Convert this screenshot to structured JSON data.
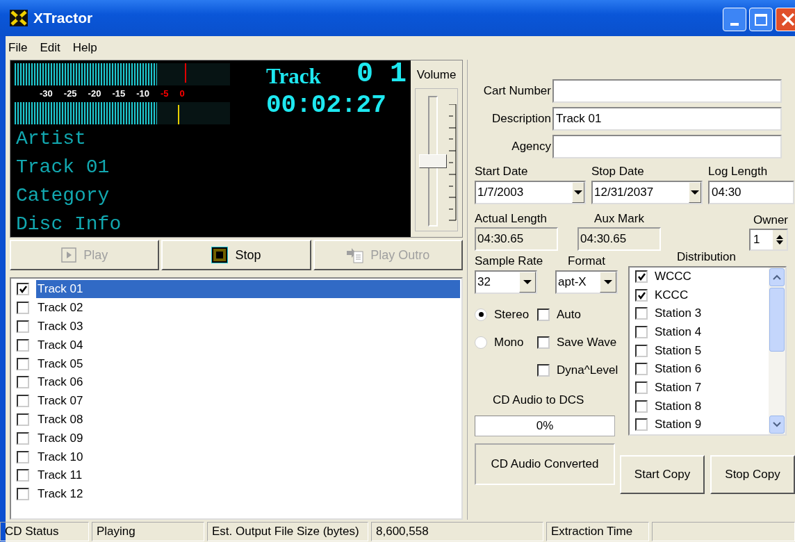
{
  "window": {
    "title": "XTractor"
  },
  "menu": [
    "File",
    "Edit",
    "Help"
  ],
  "display": {
    "meters": [
      {
        "level": 0.66
      },
      {
        "level": 0.66
      }
    ],
    "scale": [
      {
        "label": "-30",
        "color": "#ffffff"
      },
      {
        "label": "-25",
        "color": "#ffffff"
      },
      {
        "label": "-20",
        "color": "#ffffff"
      },
      {
        "label": "-15",
        "color": "#ffffff"
      },
      {
        "label": "-10",
        "color": "#ffffff"
      },
      {
        "label": "-5",
        "color": "#ff0000"
      },
      {
        "label": "0",
        "color": "#ff0000"
      }
    ],
    "track_label": "Track",
    "track_number": "0 1",
    "time": "00:02:27",
    "info_lines": [
      "Artist",
      "Track 01",
      "Category",
      "Disc Info"
    ]
  },
  "volume": {
    "label": "Volume",
    "level": 0.5
  },
  "transport": [
    {
      "label": "Play",
      "kind": "play",
      "disabled": true
    },
    {
      "label": "Stop",
      "kind": "stop",
      "disabled": false
    },
    {
      "label": "Play Outro",
      "kind": "outro",
      "disabled": true
    }
  ],
  "tracks": [
    {
      "label": "Track 01",
      "checked": true,
      "selected": true
    },
    {
      "label": "Track 02",
      "checked": false,
      "selected": false
    },
    {
      "label": "Track 03",
      "checked": false,
      "selected": false
    },
    {
      "label": "Track 04",
      "checked": false,
      "selected": false
    },
    {
      "label": "Track 05",
      "checked": false,
      "selected": false
    },
    {
      "label": "Track 06",
      "checked": false,
      "selected": false
    },
    {
      "label": "Track 07",
      "checked": false,
      "selected": false
    },
    {
      "label": "Track 08",
      "checked": false,
      "selected": false
    },
    {
      "label": "Track 09",
      "checked": false,
      "selected": false
    },
    {
      "label": "Track 10",
      "checked": false,
      "selected": false
    },
    {
      "label": "Track 11",
      "checked": false,
      "selected": false
    },
    {
      "label": "Track 12",
      "checked": false,
      "selected": false
    }
  ],
  "fields": [
    {
      "label": "Cart Number"
    },
    {
      "label": "Description",
      "value": "Track 01"
    },
    {
      "label": "Agency"
    }
  ],
  "dates": [
    {
      "label": "Start Date",
      "value": "1/7/2003",
      "kind": "dropdown"
    },
    {
      "label": "Stop Date",
      "value": "12/31/2037",
      "kind": "dropdown"
    },
    {
      "label": "Log Length",
      "value": "04:30",
      "kind": "text"
    }
  ],
  "lengths": [
    {
      "label": "Actual Length",
      "value": "04:30.65"
    },
    {
      "label": "Aux Mark",
      "value": "04:30.65"
    }
  ],
  "owner": {
    "label": "Owner",
    "value": "1"
  },
  "sample_rate": {
    "label": "Sample Rate",
    "value": "32"
  },
  "format": {
    "label": "Format",
    "value": "apt-X"
  },
  "channels": [
    {
      "label": "Stereo",
      "selected": true
    },
    {
      "label": "Mono",
      "selected": false
    }
  ],
  "options": [
    {
      "label": "Auto",
      "checked": false
    },
    {
      "label": "Save Wave",
      "checked": false
    },
    {
      "label": "Dyna^Level",
      "checked": false
    }
  ],
  "conversion": {
    "label": "CD Audio to DCS",
    "progress": {
      "text": "0%",
      "level": 0
    },
    "status": "CD Audio Converted"
  },
  "distribution": {
    "label": "Distribution",
    "stations": [
      {
        "label": "WCCC",
        "checked": true
      },
      {
        "label": "KCCC",
        "checked": true
      },
      {
        "label": "Station 3",
        "checked": false
      },
      {
        "label": "Station 4",
        "checked": false
      },
      {
        "label": "Station 5",
        "checked": false
      },
      {
        "label": "Station 6",
        "checked": false
      },
      {
        "label": "Station 7",
        "checked": false
      },
      {
        "label": "Station 8",
        "checked": false
      },
      {
        "label": "Station 9",
        "checked": false
      }
    ]
  },
  "buttons": [
    "Start Copy",
    "Stop Copy"
  ],
  "status_bar": [
    "CD Status",
    "Playing",
    "Est. Output File Size (bytes)",
    "8,600,558",
    "Extraction Time"
  ]
}
